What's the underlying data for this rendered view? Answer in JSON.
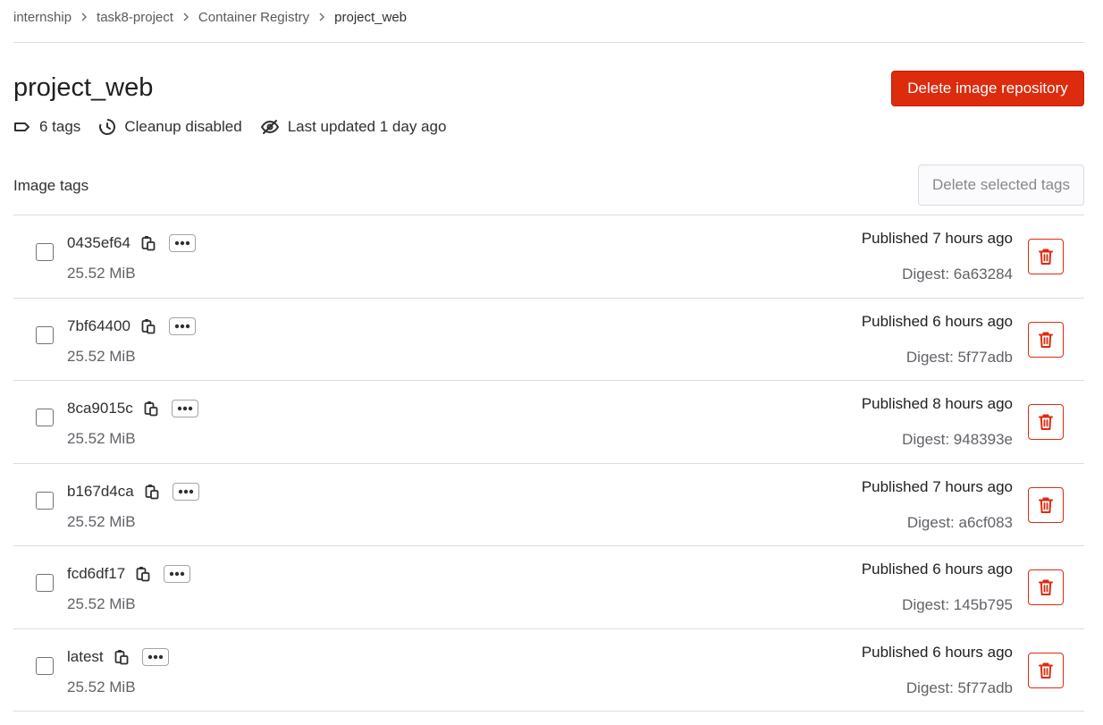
{
  "breadcrumb": [
    "internship",
    "task8-project",
    "Container Registry",
    "project_web"
  ],
  "title": "project_web",
  "delete_repo_label": "Delete image repository",
  "meta": {
    "tags": "6 tags",
    "cleanup": "Cleanup disabled",
    "updated": "Last updated 1 day ago"
  },
  "section_label": "Image tags",
  "delete_selected_label": "Delete selected tags",
  "rows": [
    {
      "name": "0435ef64",
      "size": "25.52 MiB",
      "published": "Published 7 hours ago",
      "digest": "Digest: 6a63284"
    },
    {
      "name": "7bf64400",
      "size": "25.52 MiB",
      "published": "Published 6 hours ago",
      "digest": "Digest: 5f77adb"
    },
    {
      "name": "8ca9015c",
      "size": "25.52 MiB",
      "published": "Published 8 hours ago",
      "digest": "Digest: 948393e"
    },
    {
      "name": "b167d4ca",
      "size": "25.52 MiB",
      "published": "Published 7 hours ago",
      "digest": "Digest: a6cf083"
    },
    {
      "name": "fcd6df17",
      "size": "25.52 MiB",
      "published": "Published 6 hours ago",
      "digest": "Digest: 145b795"
    },
    {
      "name": "latest",
      "size": "25.52 MiB",
      "published": "Published 6 hours ago",
      "digest": "Digest: 5f77adb"
    }
  ],
  "icons": {
    "tag": "tag-icon",
    "cleanup": "clock-icon",
    "updated": "eye-slash-icon",
    "copy": "clipboard-icon",
    "more": "ellipsis-icon",
    "delete": "trash-icon",
    "separator": "chevron-right-icon"
  },
  "colors": {
    "danger": "#dd2b0e",
    "text": "#303030",
    "muted": "#626168",
    "border": "#dcdcde"
  }
}
